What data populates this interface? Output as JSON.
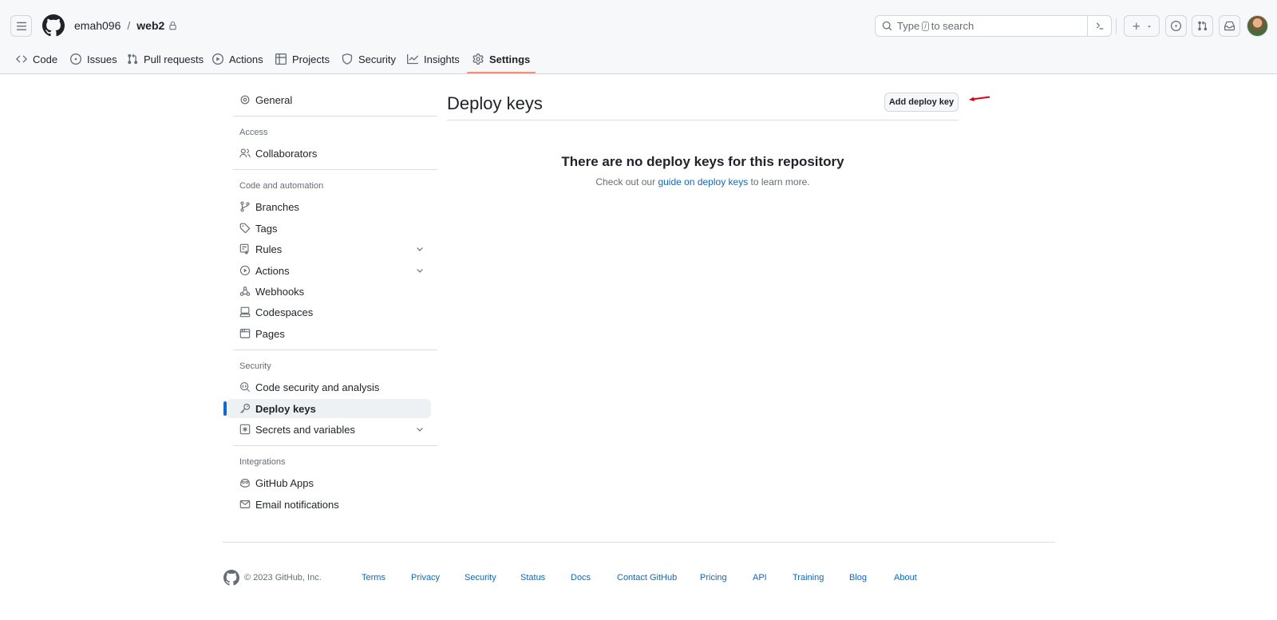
{
  "header": {
    "owner": "emah096",
    "separator": "/",
    "repo": "web2",
    "search_placeholder_prefix": "Type",
    "search_key": "/",
    "search_placeholder_suffix": "to search"
  },
  "tabs": [
    {
      "label": "Code",
      "icon": "code-icon"
    },
    {
      "label": "Issues",
      "icon": "issue-icon"
    },
    {
      "label": "Pull requests",
      "icon": "pull-request-icon"
    },
    {
      "label": "Actions",
      "icon": "play-icon"
    },
    {
      "label": "Projects",
      "icon": "table-icon"
    },
    {
      "label": "Security",
      "icon": "shield-icon"
    },
    {
      "label": "Insights",
      "icon": "graph-icon"
    },
    {
      "label": "Settings",
      "icon": "gear-icon",
      "active": true
    }
  ],
  "sidebar": {
    "general": "General",
    "access_heading": "Access",
    "collaborators": "Collaborators",
    "code_heading": "Code and automation",
    "branches": "Branches",
    "tags": "Tags",
    "rules": "Rules",
    "actions": "Actions",
    "webhooks": "Webhooks",
    "codespaces": "Codespaces",
    "pages": "Pages",
    "security_heading": "Security",
    "code_security": "Code security and analysis",
    "deploy_keys": "Deploy keys",
    "secrets": "Secrets and variables",
    "integrations_heading": "Integrations",
    "github_apps": "GitHub Apps",
    "email_notifications": "Email notifications"
  },
  "main": {
    "title": "Deploy keys",
    "add_button": "Add deploy key",
    "blank_title": "There are no deploy keys for this repository",
    "blank_prefix": "Check out our",
    "blank_link": "guide on deploy keys",
    "blank_suffix": "to learn more.",
    "annotation_color": "#e3000f"
  },
  "footer": {
    "copyright": "© 2023 GitHub, Inc.",
    "links": [
      "Terms",
      "Privacy",
      "Security",
      "Status",
      "Docs",
      "Contact GitHub",
      "Pricing",
      "API",
      "Training",
      "Blog",
      "About"
    ]
  },
  "colors": {
    "accent_link": "#0969da",
    "active_tab_underline": "#fd8c73",
    "active_sidebar_bar": "#0969da"
  }
}
